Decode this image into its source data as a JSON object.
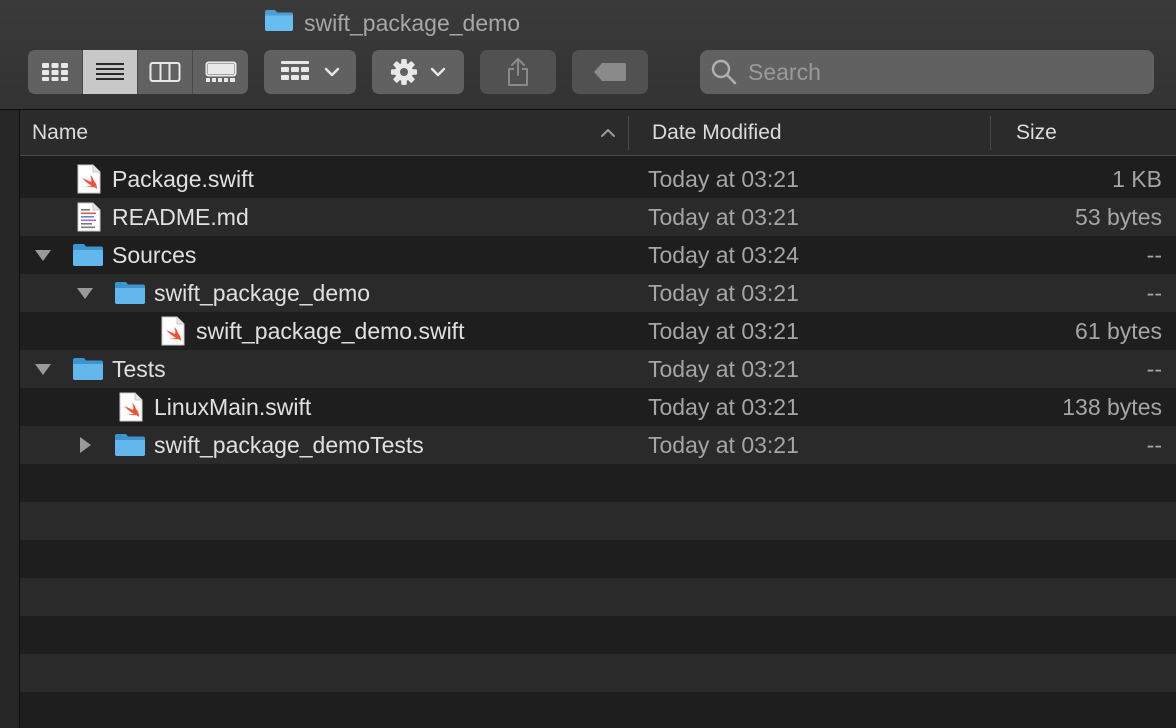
{
  "window": {
    "title": "swift_package_demo"
  },
  "toolbar": {
    "search_placeholder": "Search",
    "view_buttons": [
      "icon-view",
      "list-view",
      "column-view",
      "gallery-view"
    ],
    "active_view": "list-view"
  },
  "columns": {
    "name": "Name",
    "date": "Date Modified",
    "size": "Size"
  },
  "files": [
    {
      "name": "Package.swift",
      "date": "Today at 03:21",
      "size": "1 KB",
      "kind": "swift-file",
      "level": 0,
      "disclosure": "none"
    },
    {
      "name": "README.md",
      "date": "Today at 03:21",
      "size": "53 bytes",
      "kind": "text-file",
      "level": 0,
      "disclosure": "none"
    },
    {
      "name": "Sources",
      "date": "Today at 03:24",
      "size": "--",
      "kind": "folder",
      "level": 0,
      "disclosure": "expanded"
    },
    {
      "name": "swift_package_demo",
      "date": "Today at 03:21",
      "size": "--",
      "kind": "folder",
      "level": 1,
      "disclosure": "expanded"
    },
    {
      "name": "swift_package_demo.swift",
      "date": "Today at 03:21",
      "size": "61 bytes",
      "kind": "swift-file",
      "level": 2,
      "disclosure": "none"
    },
    {
      "name": "Tests",
      "date": "Today at 03:21",
      "size": "--",
      "kind": "folder",
      "level": 0,
      "disclosure": "expanded"
    },
    {
      "name": "LinuxMain.swift",
      "date": "Today at 03:21",
      "size": "138 bytes",
      "kind": "swift-file",
      "level": 1,
      "disclosure": "none"
    },
    {
      "name": "swift_package_demoTests",
      "date": "Today at 03:21",
      "size": "--",
      "kind": "folder",
      "level": 1,
      "disclosure": "collapsed"
    }
  ],
  "colors": {
    "folder": "#5fb3e6",
    "swift": "#f05138",
    "background": "#1e1e1e",
    "row_alt": "#2a2a2a"
  }
}
